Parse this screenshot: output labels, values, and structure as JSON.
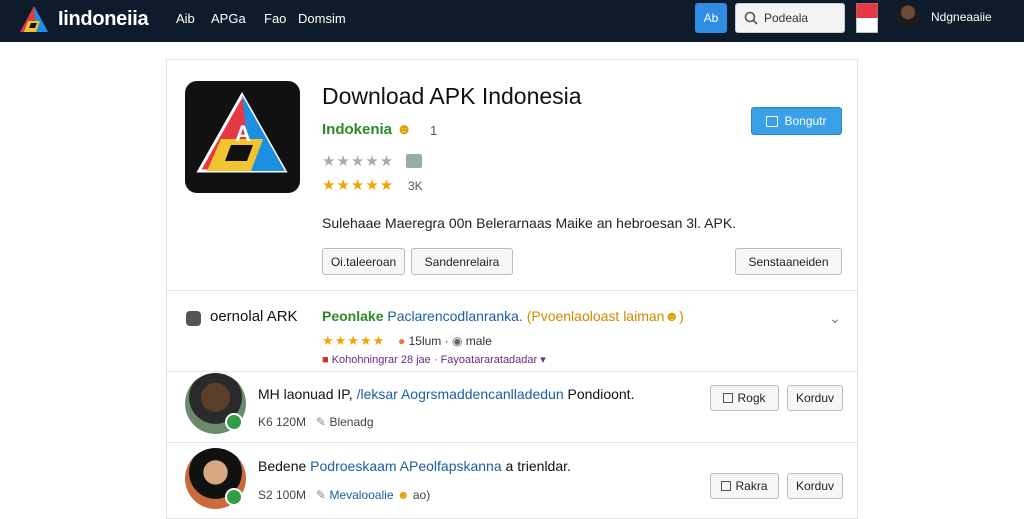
{
  "topbar": {
    "brand": "Iindoneiia",
    "nav": [
      "Aib",
      "APGa",
      "Fao",
      "Domsim"
    ],
    "ab_button": "Ab",
    "search_placeholder": "Podeala",
    "user_name": "Ndgneaaiie"
  },
  "app": {
    "title": "Download APK Indonesia",
    "developer": "Indokenia",
    "developer_count": "1",
    "rating_count": "3K",
    "install_button": "Bongutr",
    "description": "Sulehaae  Maeregra 00n Belerarnaas Maike an hebroesan 3l. APK.",
    "button_1": "Oi.taleeroan",
    "button_2": "Sandenrelaira",
    "button_3": "Senstaaneiden"
  },
  "section": {
    "title": "oernolal ARK",
    "headline_green": "Peonlake",
    "headline_blue": "Paclarencodlanranka.",
    "headline_orange": "(Pvoenlaoloast laiman",
    "meta_1": "15lum",
    "meta_2": "male",
    "sub_1": "Kohohningrar 28 jae",
    "sub_2": "Fayoatararatadadar"
  },
  "reviews": [
    {
      "text_black": "MH laonuad IP, ",
      "text_blue": "/leksar Aogrsmaddencanlladedun",
      "text_tail": " Pondioont.",
      "meta_1": "K6 120M",
      "meta_2": "Blenadg",
      "btn_1": "Rogk",
      "btn_2": "Korduv"
    },
    {
      "text_black": "Bedene ",
      "text_blue": "Podroeskaam APeolfapskanna",
      "text_tail": " a trienldar.",
      "meta_1": "S2 100M",
      "meta_2": "Mevalooalie",
      "meta_3": "ao",
      "btn_1": "Rakra",
      "btn_2": "Korduv"
    }
  ]
}
